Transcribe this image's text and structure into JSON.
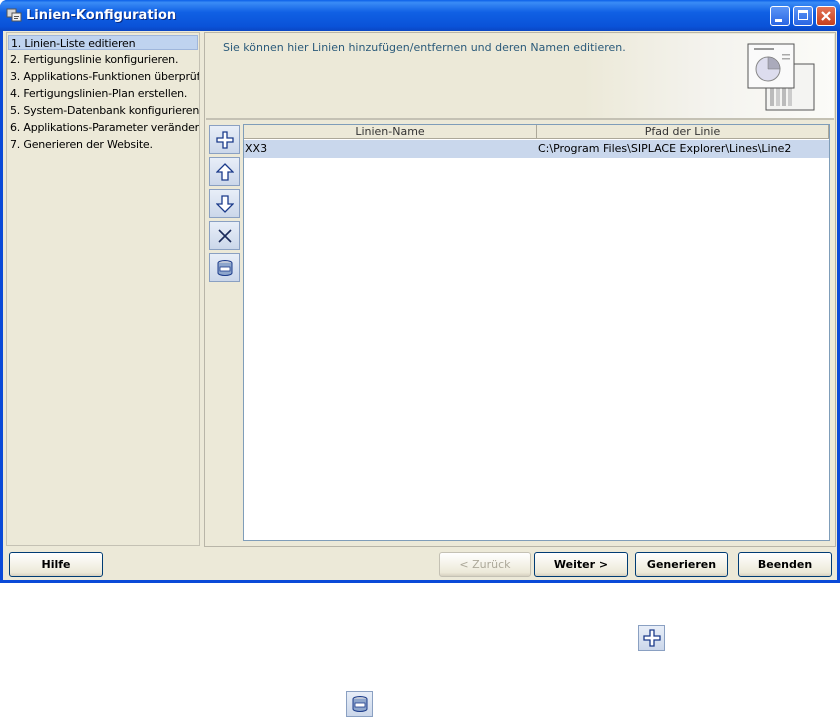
{
  "window": {
    "title": "Linien-Konfiguration"
  },
  "steps": [
    {
      "label": "1. Linien-Liste editieren",
      "active": true
    },
    {
      "label": "2. Fertigungslinie konfigurieren.",
      "active": false
    },
    {
      "label": "3. Applikations-Funktionen überprüf",
      "active": false
    },
    {
      "label": "4. Fertigungslinien-Plan erstellen.",
      "active": false
    },
    {
      "label": "5. System-Datenbank konfigurieren",
      "active": false
    },
    {
      "label": "6. Applikations-Parameter veränder",
      "active": false
    },
    {
      "label": "7. Generieren der Website.",
      "active": false
    }
  ],
  "banner": {
    "text": "Sie können hier Linien hinzufügen/entfernen und deren Namen editieren."
  },
  "toolbar": {
    "icons": [
      "add-icon",
      "move-up-icon",
      "move-down-icon",
      "delete-icon",
      "database-icon"
    ]
  },
  "table": {
    "columns": [
      "Linien-Name",
      "Pfad der Linie"
    ],
    "rows": [
      {
        "name": "XX3",
        "path": "C:\\Program Files\\SIPLACE Explorer\\Lines\\Line2",
        "selected": true
      }
    ]
  },
  "buttons": {
    "help": "Hilfe",
    "back": "< Zurück",
    "next": "Weiter >",
    "generate": "Generieren",
    "finish": "Beenden"
  },
  "colors": {
    "titlebar": "#0a52d8",
    "selection": "#c9d7ec",
    "banner_text": "#2a5a7a"
  }
}
